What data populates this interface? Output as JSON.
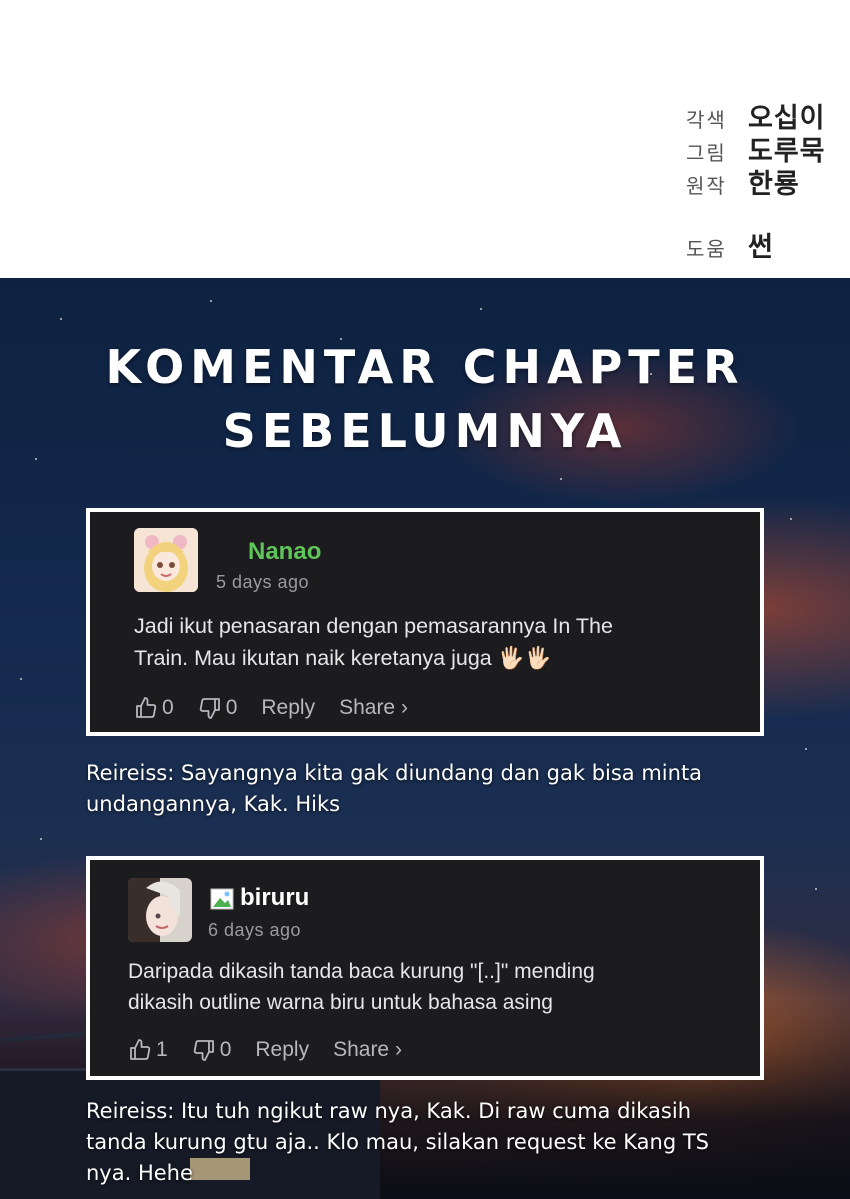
{
  "credits": [
    {
      "role": "각색",
      "name": "오십이"
    },
    {
      "role": "그림",
      "name": "도루묵"
    },
    {
      "role": "원작",
      "name": "한룡"
    },
    {
      "role": "도움",
      "name": "썬"
    }
  ],
  "section_title_line1": "KOMENTAR CHAPTER",
  "section_title_line2": "SEBELUMNYA",
  "comments": [
    {
      "username": "Nanao",
      "username_color": "#5fc45a",
      "timestamp": "5 days ago",
      "text_line1": "Jadi ikut penasaran dengan pemasarannya In The",
      "text_line2": "Train. Mau ikutan naik keretanya juga 🖐🏻🖐🏻",
      "likes": "0",
      "dislikes": "0",
      "reply_label": "Reply",
      "share_label": "Share ›",
      "avatar_icon": "anime-girl-avatar"
    },
    {
      "username": "biruru",
      "username_color": "#ffffff",
      "timestamp": "6 days ago",
      "text_line1": "Daripada dikasih tanda baca kurung \"[..]\" mending",
      "text_line2": "dikasih outline warna biru untuk bahasa asing",
      "likes": "1",
      "dislikes": "0",
      "reply_label": "Reply",
      "share_label": "Share ›",
      "avatar_icon": "anime-character-avatar",
      "badge_icon": "broken-image-icon"
    }
  ],
  "replies": [
    {
      "line1": "Reireiss: Sayangnya kita gak diundang dan gak bisa minta",
      "line2": "undangannya, Kak. Hiks"
    },
    {
      "line1": "Reireiss: Itu tuh ngikut raw nya, Kak. Di raw cuma dikasih",
      "line2": "tanda kurung gtu aja.. Klo mau, silakan request ke Kang TS",
      "line3": "nya. Hehe"
    }
  ]
}
